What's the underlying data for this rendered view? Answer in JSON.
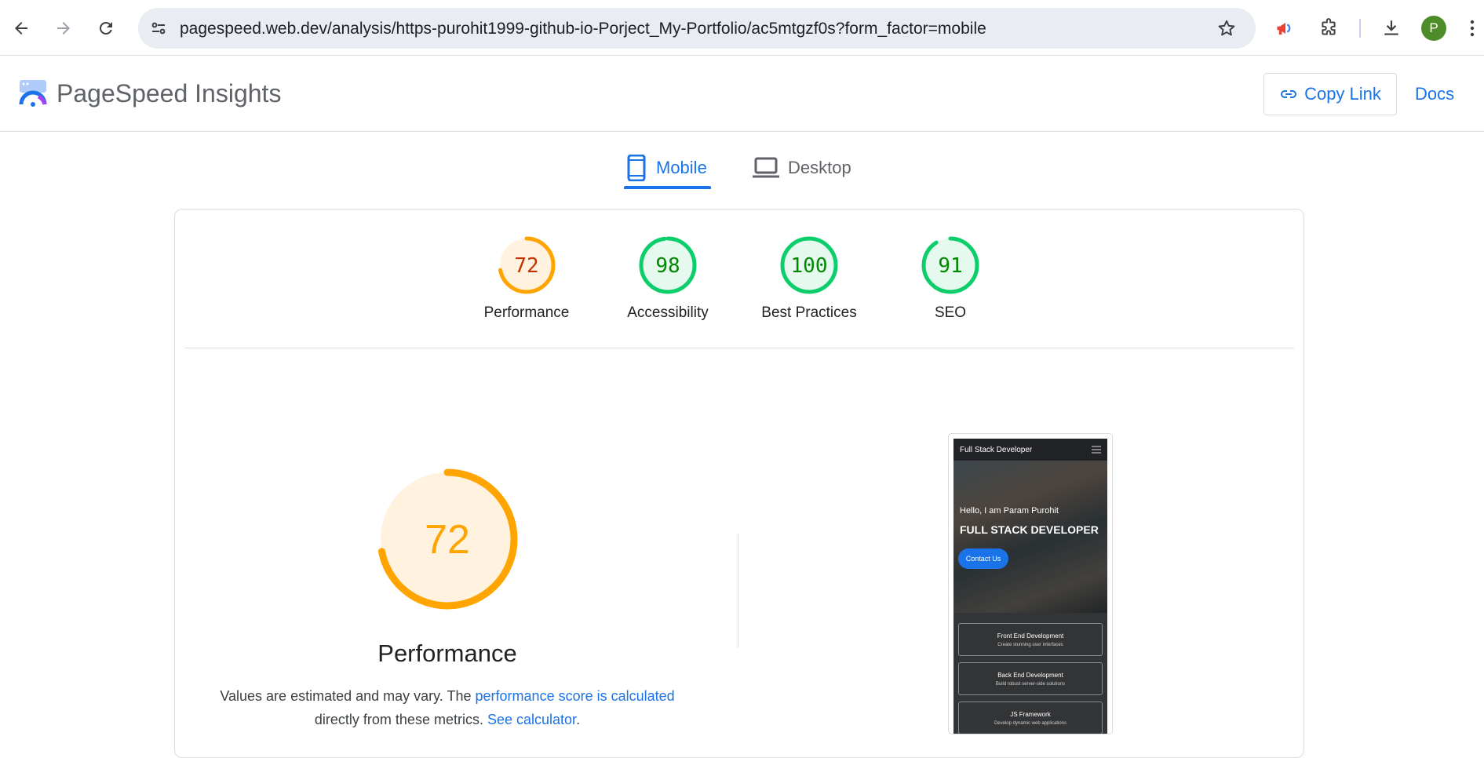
{
  "browser": {
    "url": "pagespeed.web.dev/analysis/https-purohit1999-github-io-Porject_My-Portfolio/ac5mtgzf0s?form_factor=mobile",
    "avatar_letter": "P",
    "icons": [
      "back-arrow-icon",
      "forward-arrow-icon",
      "reload-icon",
      "site-settings-icon",
      "bookmark-star-icon",
      "megaphone-extension-icon",
      "extensions-puzzle-icon",
      "download-icon",
      "more-vert-icon"
    ]
  },
  "header": {
    "title": "PageSpeed Insights",
    "copy_link": "Copy Link",
    "docs": "Docs"
  },
  "tabs": [
    {
      "label": "Mobile",
      "active": true
    },
    {
      "label": "Desktop",
      "active": false
    }
  ],
  "scores": [
    {
      "label": "Performance",
      "value": 72,
      "status": "average"
    },
    {
      "label": "Accessibility",
      "value": 98,
      "status": "good"
    },
    {
      "label": "Best Practices",
      "value": 100,
      "status": "good"
    },
    {
      "label": "SEO",
      "value": 91,
      "status": "good"
    }
  ],
  "colors": {
    "average_stroke": "#ffa400",
    "average_fill": "#fff3e0",
    "average_text": "#c33300",
    "good_stroke": "#0cce6b",
    "good_fill": "#e6f9ee",
    "good_text": "#008800",
    "link": "#1a73e8"
  },
  "performance": {
    "score": 72,
    "title": "Performance",
    "desc_prefix": "Values are estimated and may vary. The",
    "desc_link1": "performance score is calculated",
    "desc_middle": "directly from these metrics.",
    "desc_link2": "See calculator",
    "desc_suffix": "."
  },
  "screenshot": {
    "site_title": "Full Stack Developer",
    "hello": "Hello, I am Param Purohit",
    "headline": "FULL STACK DEVELOPER",
    "contact": "Contact Us",
    "services": [
      {
        "title": "Front End Development",
        "sub": "Create stunning user interfaces"
      },
      {
        "title": "Back End Development",
        "sub": "Build robust server-side solutions"
      },
      {
        "title": "JS Framework",
        "sub": "Develop dynamic web applications"
      }
    ]
  }
}
